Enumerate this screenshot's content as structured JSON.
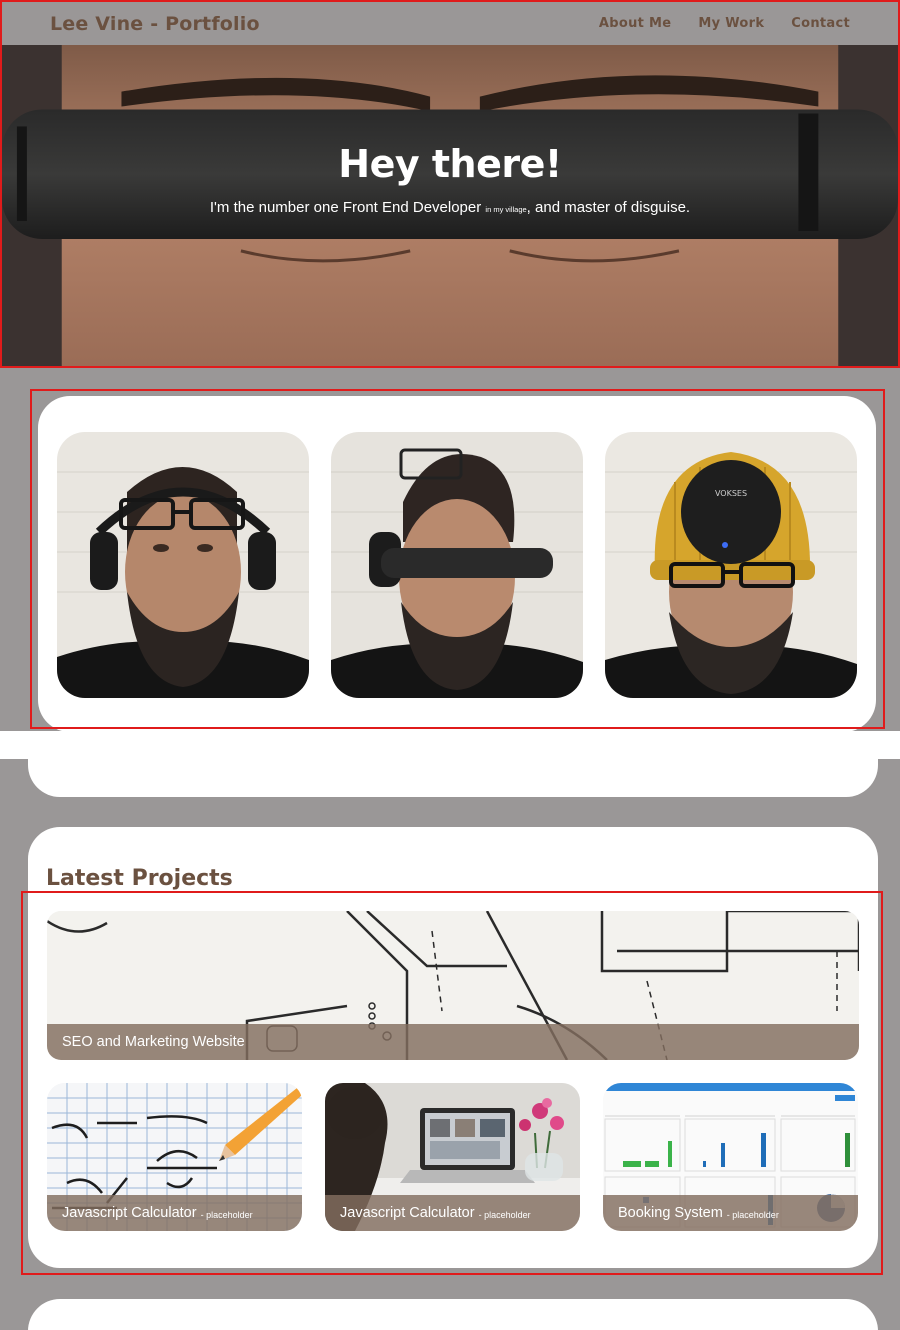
{
  "header": {
    "brand": "Lee Vine - Portfolio",
    "nav": [
      "About Me",
      "My Work",
      "Contact"
    ]
  },
  "hero": {
    "title": "Hey there!",
    "subtitle_before": "I'm the number one Front End Developer ",
    "subtitle_small": "in my village",
    "subtitle_after": ", and master of disguise."
  },
  "photos": {
    "headphone_brand": "VOKSES"
  },
  "projects": {
    "title": "Latest Projects",
    "items": [
      {
        "name": "SEO and Marketing Website",
        "tag": ""
      },
      {
        "name": "Javascript Calculator",
        "tag": "- placeholder"
      },
      {
        "name": "Javascript Calculator",
        "tag": "- placeholder"
      },
      {
        "name": "Booking System",
        "tag": "- placeholder"
      }
    ]
  },
  "colors": {
    "page_bg": "#9a9797",
    "brand_brown": "#6b5140",
    "caption_overlay": "#826e5f",
    "highlight_outline": "#e01b1b"
  }
}
